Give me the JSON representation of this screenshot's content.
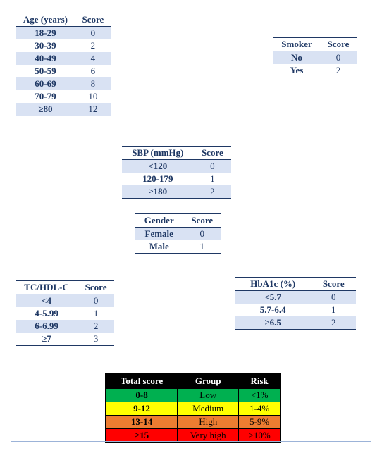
{
  "age": {
    "headers": [
      "Age (years)",
      "Score"
    ],
    "rows": [
      {
        "label": "18-29",
        "score": "0"
      },
      {
        "label": "30-39",
        "score": "2"
      },
      {
        "label": "40-49",
        "score": "4"
      },
      {
        "label": "50-59",
        "score": "6"
      },
      {
        "label": "60-69",
        "score": "8"
      },
      {
        "label": "70-79",
        "score": "10"
      },
      {
        "label": "≥80",
        "score": "12"
      }
    ]
  },
  "smoker": {
    "headers": [
      "Smoker",
      "Score"
    ],
    "rows": [
      {
        "label": "No",
        "score": "0"
      },
      {
        "label": "Yes",
        "score": "2"
      }
    ]
  },
  "sbp": {
    "headers": [
      "SBP (mmHg)",
      "Score"
    ],
    "rows": [
      {
        "label": "<120",
        "score": "0"
      },
      {
        "label": "120-179",
        "score": "1"
      },
      {
        "label": "≥180",
        "score": "2"
      }
    ]
  },
  "gender": {
    "headers": [
      "Gender",
      "Score"
    ],
    "rows": [
      {
        "label": "Female",
        "score": "0"
      },
      {
        "label": "Male",
        "score": "1"
      }
    ]
  },
  "tc": {
    "headers": [
      "TC/HDL-C",
      "Score"
    ],
    "rows": [
      {
        "label": "<4",
        "score": "0"
      },
      {
        "label": "4-5.99",
        "score": "1"
      },
      {
        "label": "6-6.99",
        "score": "2"
      },
      {
        "label": "≥7",
        "score": "3"
      }
    ]
  },
  "hba1c": {
    "headers": [
      "HbA1c (%)",
      "Score"
    ],
    "rows": [
      {
        "label": "<5.7",
        "score": "0"
      },
      {
        "label": "5.7-6.4",
        "score": "1"
      },
      {
        "label": "≥6.5",
        "score": "2"
      }
    ]
  },
  "total": {
    "headers": [
      "Total score",
      "Group",
      "Risk"
    ],
    "rows": [
      {
        "score": "0-8",
        "group": "Low",
        "risk": "<1%",
        "class": "row-green"
      },
      {
        "score": "9-12",
        "group": "Medium",
        "risk": "1-4%",
        "class": "row-yellow"
      },
      {
        "score": "13-14",
        "group": "High",
        "risk": "5-9%",
        "class": "row-orange"
      },
      {
        "score": "≥15",
        "group": "Very high",
        "risk": ">10%",
        "class": "row-red"
      }
    ]
  },
  "chart_data": {
    "type": "table",
    "title": "Cardiovascular risk score tables",
    "tables": {
      "Age (years)": {
        "18-29": 0,
        "30-39": 2,
        "40-49": 4,
        "50-59": 6,
        "60-69": 8,
        "70-79": 10,
        "≥80": 12
      },
      "Smoker": {
        "No": 0,
        "Yes": 2
      },
      "SBP (mmHg)": {
        "<120": 0,
        "120-179": 1,
        "≥180": 2
      },
      "Gender": {
        "Female": 0,
        "Male": 1
      },
      "TC/HDL-C": {
        "<4": 0,
        "4-5.99": 1,
        "6-6.99": 2,
        "≥7": 3
      },
      "HbA1c (%)": {
        "<5.7": 0,
        "5.7-6.4": 1,
        "≥6.5": 2
      }
    },
    "risk_groups": [
      {
        "total_score": "0-8",
        "group": "Low",
        "risk": "<1%",
        "color": "#00b050"
      },
      {
        "total_score": "9-12",
        "group": "Medium",
        "risk": "1-4%",
        "color": "#ffff00"
      },
      {
        "total_score": "13-14",
        "group": "High",
        "risk": "5-9%",
        "color": "#ed7d31"
      },
      {
        "total_score": "≥15",
        "group": "Very high",
        "risk": ">10%",
        "color": "#ff0000"
      }
    ]
  }
}
